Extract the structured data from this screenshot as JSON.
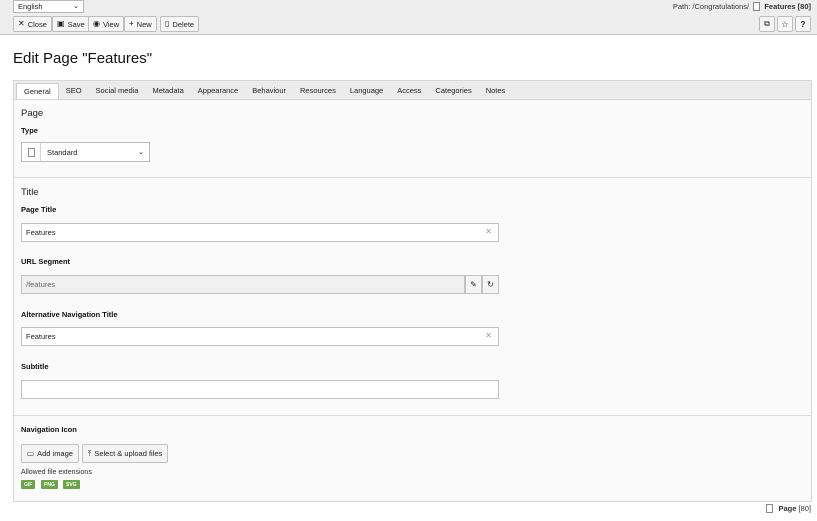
{
  "language": {
    "selected": "English"
  },
  "path": {
    "label": "Path: /Congratulations/",
    "page": "Features [80]"
  },
  "toolbar": {
    "close": "Close",
    "save": "Save",
    "view": "View",
    "new": "New",
    "delete": "Delete"
  },
  "title": "Edit Page \"Features\"",
  "tabs": [
    "General",
    "SEO",
    "Social media",
    "Metadata",
    "Appearance",
    "Behaviour",
    "Resources",
    "Language",
    "Access",
    "Categories",
    "Notes"
  ],
  "active_tab": "General",
  "page_section": {
    "title": "Page",
    "type_label": "Type",
    "type_value": "Standard"
  },
  "title_section": {
    "title": "Title",
    "page_title_label": "Page Title",
    "page_title_value": "Features",
    "url_label": "URL Segment",
    "url_value": "/features",
    "alt_nav_label": "Alternative Navigation Title",
    "alt_nav_value": "Features",
    "subtitle_label": "Subtitle",
    "subtitle_value": ""
  },
  "nav_icon": {
    "label": "Navigation Icon",
    "add_image": "Add image",
    "select_upload": "Select & upload files",
    "allowed": "Allowed file extensions",
    "extensions": [
      "GIF",
      "PNG",
      "SVG"
    ],
    "badge_color": "#6aa547"
  },
  "footer": {
    "label": "Page",
    "id": "[80]"
  }
}
